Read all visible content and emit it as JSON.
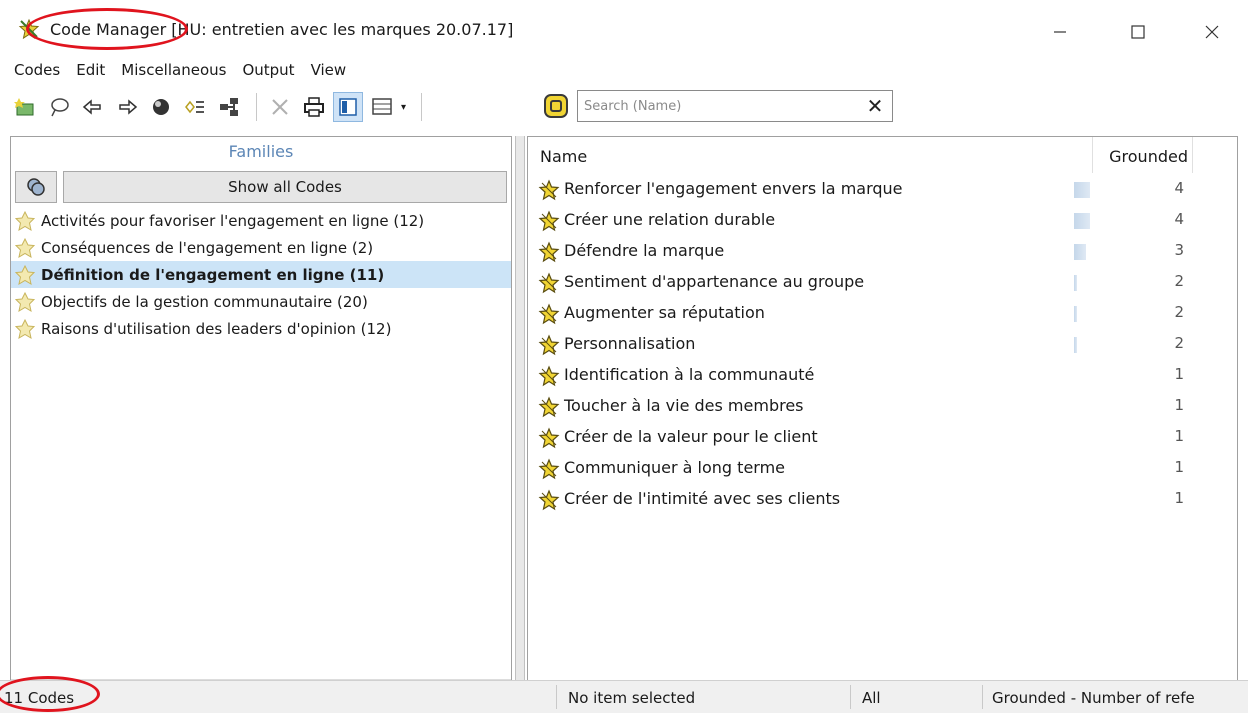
{
  "window": {
    "app_name": "Code Manager",
    "title_rest": "[HU: entretien avec les marques 20.07.17]"
  },
  "menu": [
    "Codes",
    "Edit",
    "Miscellaneous",
    "Output",
    "View"
  ],
  "toolbar": {
    "icons": [
      "new-code-icon",
      "comment-icon",
      "back-arrow-icon",
      "forward-arrow-icon",
      "color-circle-icon",
      "merge-codes-icon",
      "tree-icon",
      "delete-icon",
      "print-icon",
      "single-pane-icon",
      "grid-view-icon"
    ]
  },
  "search": {
    "placeholder": "Search (Name)",
    "value": ""
  },
  "families": {
    "header": "Families",
    "show_all_label": "Show all Codes",
    "items": [
      {
        "label": "Activités pour favoriser l'engagement en ligne (12)",
        "selected": false
      },
      {
        "label": "Conséquences de l'engagement en ligne (2)",
        "selected": false
      },
      {
        "label": "Définition de l'engagement en ligne (11)",
        "selected": true
      },
      {
        "label": "Objectifs de la gestion communautaire (20)",
        "selected": false
      },
      {
        "label": "Raisons d'utilisation des leaders d'opinion (12)",
        "selected": false
      }
    ]
  },
  "codes": {
    "col_name": "Name",
    "col_grounded": "Grounded",
    "rows": [
      {
        "name": "Renforcer l'engagement envers la marque",
        "grounded": "4"
      },
      {
        "name": "Créer une relation durable",
        "grounded": "4"
      },
      {
        "name": "Défendre la marque",
        "grounded": "3"
      },
      {
        "name": "Sentiment d'appartenance au groupe",
        "grounded": "2"
      },
      {
        "name": "Augmenter sa réputation",
        "grounded": "2"
      },
      {
        "name": "Personnalisation",
        "grounded": "2"
      },
      {
        "name": "Identification à la communauté",
        "grounded": "1"
      },
      {
        "name": "Toucher à la vie des membres",
        "grounded": "1"
      },
      {
        "name": "Créer de la valeur pour le client",
        "grounded": "1"
      },
      {
        "name": "Communiquer à long terme",
        "grounded": "1"
      },
      {
        "name": "Créer de l'intimité avec ses clients",
        "grounded": "1"
      }
    ]
  },
  "status": {
    "count": "11 Codes",
    "selection": "No item selected",
    "filter": "All",
    "sort": "Grounded - Number of refe"
  },
  "colors": {
    "annotation": "#e0141e",
    "selection": "#cce4f7",
    "families_header": "#5c86b6"
  }
}
